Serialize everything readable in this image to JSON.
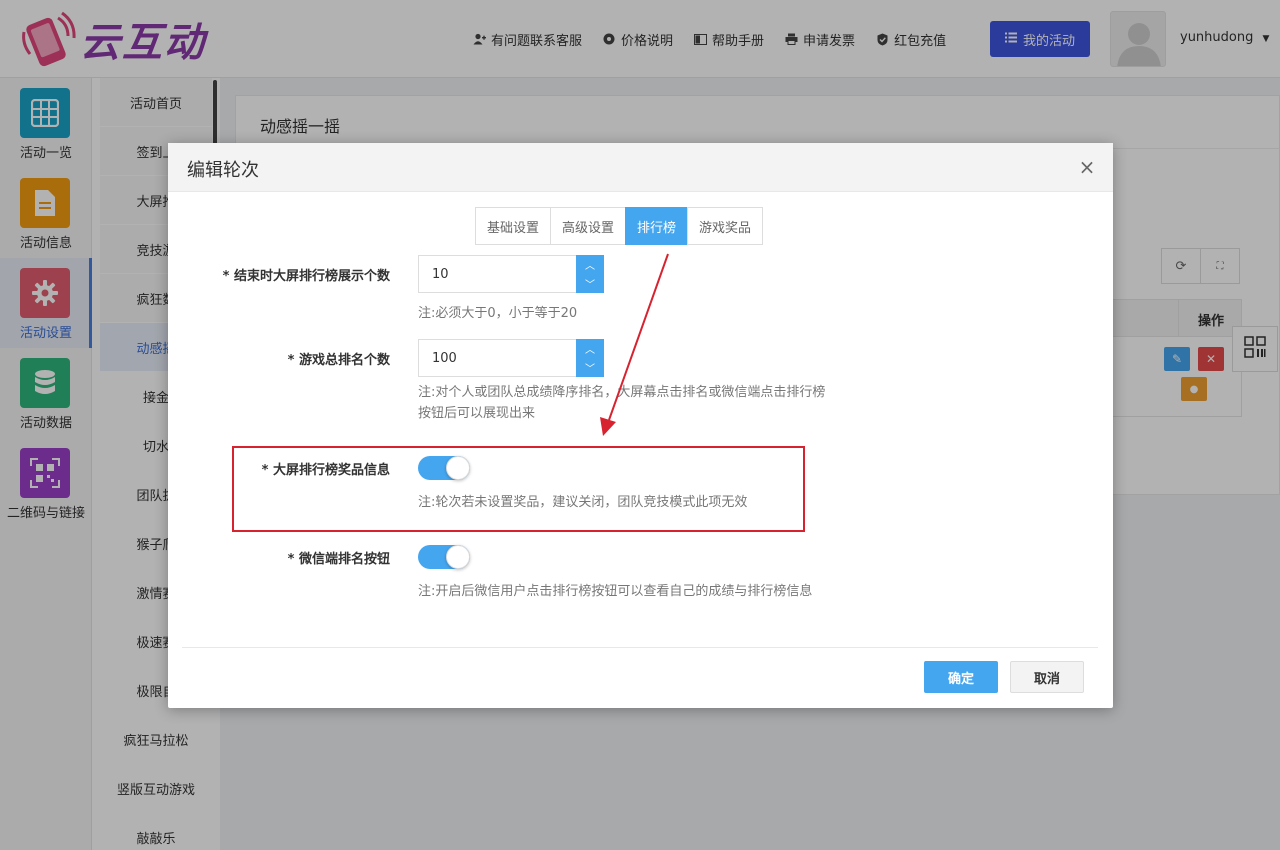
{
  "header": {
    "logo_text": "云互动",
    "nav": [
      {
        "label": "有问题联系客服",
        "icon": "user-plus-icon"
      },
      {
        "label": "价格说明",
        "icon": "gear-icon"
      },
      {
        "label": "帮助手册",
        "icon": "book-icon"
      },
      {
        "label": "申请发票",
        "icon": "printer-icon"
      },
      {
        "label": "红包充值",
        "icon": "shield-check-icon"
      }
    ],
    "my_activity": "我的活动",
    "username": "yunhudong"
  },
  "sidebar": {
    "items": [
      {
        "label": "活动一览",
        "color": "#1aa3c8",
        "icon": "grid-icon"
      },
      {
        "label": "活动信息",
        "color": "#f39c12",
        "icon": "document-icon"
      },
      {
        "label": "活动设置",
        "color": "#e05d6f",
        "icon": "gear-icon"
      },
      {
        "label": "活动数据",
        "color": "#2fb67c",
        "icon": "database-icon"
      },
      {
        "label": "二维码与链接",
        "color": "#9b3fc9",
        "icon": "qrcode-icon"
      }
    ]
  },
  "submenu": {
    "items": [
      "活动首页",
      "签到上",
      "大屏推",
      "竞技游",
      "疯狂数",
      "动感摇",
      "接金",
      "切水",
      "团队拔",
      "猴子爬",
      "激情赛",
      "极速赛",
      "极限自",
      "疯狂马拉松",
      "竖版互动游戏",
      "敲敲乐"
    ]
  },
  "content": {
    "title": "动感摇一摇",
    "table_op_header": "操作"
  },
  "modal": {
    "title": "编辑轮次",
    "close": "×",
    "tabs": [
      "基础设置",
      "高级设置",
      "排行榜",
      "游戏奖品"
    ],
    "fields": {
      "end_rank_count": {
        "label": "* 结束时大屏排行榜展示个数",
        "value": "10",
        "note": "注:必须大于0，小于等于20"
      },
      "total_rank_count": {
        "label": "* 游戏总排名个数",
        "value": "100",
        "note_line1": "注:对个人或团队总成绩降序排名，大屏幕点击排名或微信端点击排行榜",
        "note_line2": "按钮后可以展现出来"
      },
      "rank_prize_info": {
        "label": "* 大屏排行榜奖品信息",
        "enabled": true,
        "note": "注:轮次若未设置奖品，建议关闭，团队竞技模式此项无效"
      },
      "wechat_rank_button": {
        "label": "* 微信端排名按钮",
        "enabled": true,
        "note": "注:开启后微信用户点击排行榜按钮可以查看自己的成绩与排行榜信息"
      }
    },
    "ok": "确定",
    "cancel": "取消"
  },
  "colors": {
    "primary_blue": "#45a6f0",
    "nav_button": "#3d55e0",
    "annotation_red": "#d7232f"
  }
}
